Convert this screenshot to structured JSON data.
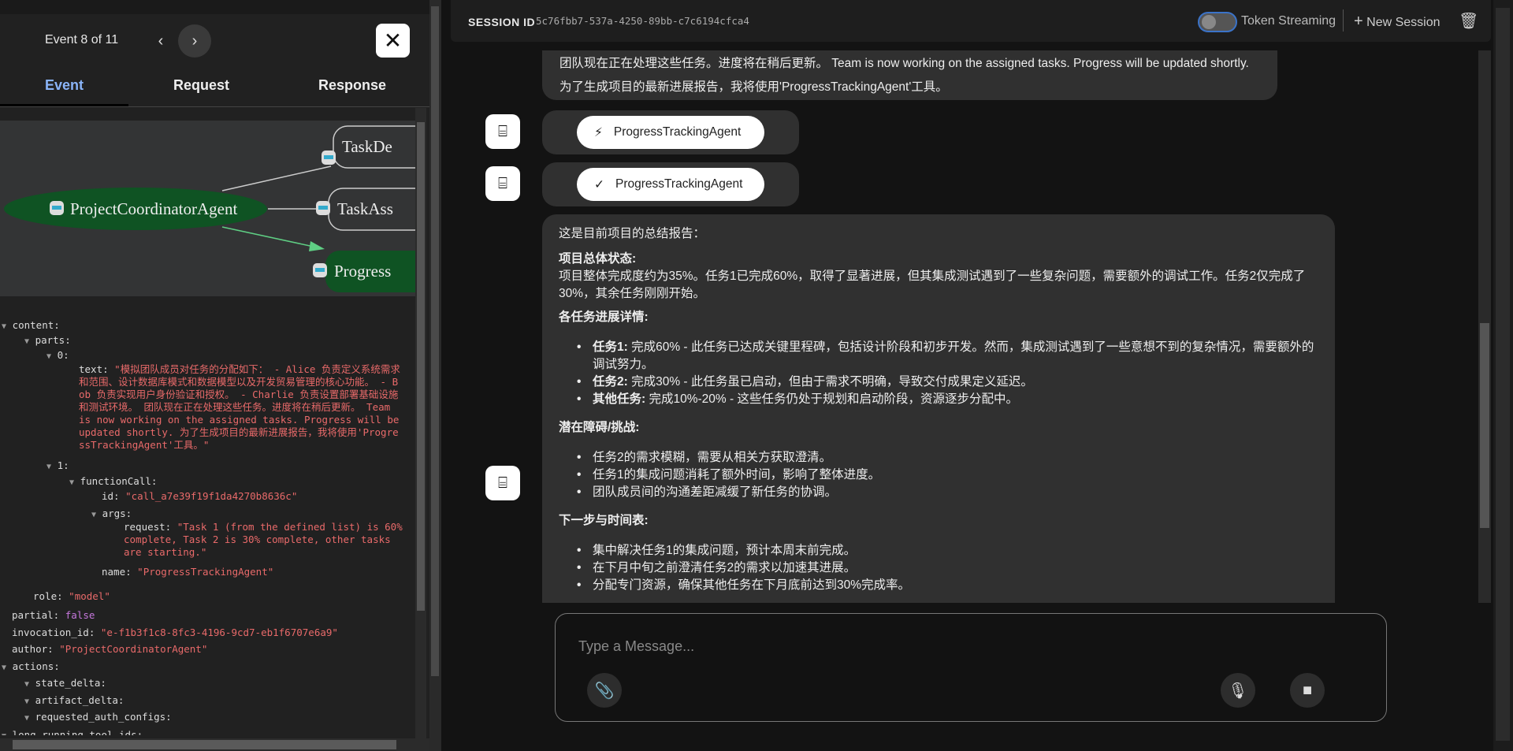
{
  "event_panel": {
    "counter": "Event 8 of 11",
    "tabs": [
      "Event",
      "Request",
      "Response"
    ],
    "active_tab": "Event",
    "graph": {
      "nodes": [
        "ProjectCoordinatorAgent",
        "TaskDe",
        "TaskAss",
        "Progress"
      ],
      "active_node": "ProjectCoordinatorAgent",
      "highlight_color": "#0f5323",
      "edge_color": "#5fcf84"
    },
    "tree": {
      "content": "content:",
      "parts": "parts:",
      "i0": "0:",
      "text_key": "text:",
      "text_val": "\"模拟团队成员对任务的分配如下： - Alice 负责定义系统需求和范围、设计数据库模式和数据模型以及开发贸易管理的核心功能。 - Bob 负责实现用户身份验证和授权。 - Charlie 负责设置部署基础设施和测试环境。 团队现在正在处理这些任务。进度将在稍后更新。 Team is now working on the assigned tasks. Progress will be updated shortly. 为了生成项目的最新进展报告，我将使用'ProgressTrackingAgent'工具。\"",
      "i1": "1:",
      "functionCall": "functionCall:",
      "id_key": "id:",
      "id_val": "\"call_a7e39f19f1da4270b8636c\"",
      "args": "args:",
      "request_key": "request:",
      "request_val": "\"Task 1 (from the defined list) is 60% complete, Task 2 is 30% complete, other tasks are starting.\"",
      "name_key": "name:",
      "name_val": "\"ProgressTrackingAgent\"",
      "role_key": "role:",
      "role_val": "\"model\"",
      "partial_key": "partial:",
      "partial_val": "false",
      "inv_key": "invocation_id:",
      "inv_val": "\"e-f1b3f1c8-8fc3-4196-9cd7-eb1f6707e6a9\"",
      "author_key": "author:",
      "author_val": "\"ProjectCoordinatorAgent\"",
      "actions": "actions:",
      "state_delta": "state_delta:",
      "artifact_delta": "artifact_delta:",
      "rac": "requested_auth_configs:",
      "lrt": "long_running_tool_ids:"
    }
  },
  "header": {
    "session_label": "SESSION ID",
    "session_id": "5c76fbb7-537a-4250-89bb-c7c6194cfca4",
    "token_streaming": "Token Streaming",
    "token_streaming_on": false,
    "new_session": "New Session"
  },
  "chat": {
    "msg1": [
      "团队现在正在处理这些任务。进度将在稍后更新。 Team is now working on the assigned tasks. Progress will be updated shortly.",
      "为了生成项目的最新进展报告，我将使用'ProgressTrackingAgent'工具。"
    ],
    "tool_call": {
      "icon": "bolt-icon",
      "label": "ProgressTrackingAgent"
    },
    "tool_result": {
      "icon": "check-icon",
      "label": "ProgressTrackingAgent"
    },
    "report": {
      "intro": "这是目前项目的总结报告：",
      "h1": "项目总体状态:",
      "p1": "项目整体完成度约为35%。任务1已完成60%，取得了显著进展，但其集成测试遇到了一些复杂问题，需要额外的调试工作。任务2仅完成了30%，其余任务刚刚开始。",
      "h2": "各任务进展详情:",
      "tasks": [
        {
          "b": "任务1:",
          "t": " 完成60% - 此任务已达成关键里程碑，包括设计阶段和初步开发。然而，集成测试遇到了一些意想不到的复杂情况，需要额外的调试努力。"
        },
        {
          "b": "任务2:",
          "t": " 完成30% - 此任务虽已启动，但由于需求不明确，导致交付成果定义延迟。"
        },
        {
          "b": "其他任务:",
          "t": " 完成10%-20% - 这些任务仍处于规划和启动阶段，资源逐步分配中。"
        }
      ],
      "h3": "潜在障碍/挑战:",
      "risks": [
        "任务2的需求模糊，需要从相关方获取澄清。",
        "任务1的集成问题消耗了额外时间，影响了整体进度。",
        "团队成员间的沟通差距减缓了新任务的协调。"
      ],
      "h4": "下一步与时间表:",
      "steps": [
        "集中解决任务1的集成问题，预计本周末前完成。",
        "在下月中旬之前澄清任务2的需求以加速其进展。",
        "分配专门资源，确保其他任务在下月底前达到30%完成率。"
      ]
    }
  },
  "input": {
    "placeholder": "Type a Message..."
  }
}
